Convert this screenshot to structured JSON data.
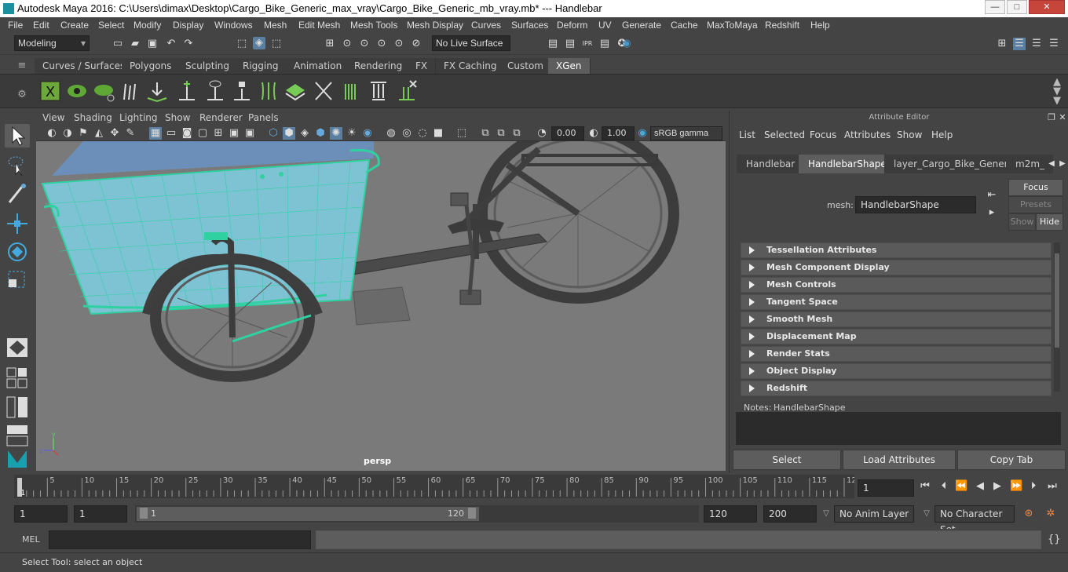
{
  "window": {
    "title": "Autodesk Maya 2016: C:\\Users\\dimax\\Desktop\\Cargo_Bike_Generic_max_vray\\Cargo_Bike_Generic_mb_vray.mb*   ---   Handlebar",
    "minimize": "—",
    "maximize": "□",
    "close": "✕"
  },
  "menu": [
    "File",
    "Edit",
    "Create",
    "Select",
    "Modify",
    "Display",
    "Windows",
    "Mesh",
    "Edit Mesh",
    "Mesh Tools",
    "Mesh Display",
    "Curves",
    "Surfaces",
    "Deform",
    "UV",
    "Generate",
    "Cache",
    "MaxToMaya",
    "Redshift",
    "Help"
  ],
  "status": {
    "mode": "Modeling",
    "live_surface": "No Live Surface"
  },
  "shelf_tabs": [
    "Curves / Surfaces",
    "Polygons",
    "Sculpting",
    "Rigging",
    "Animation",
    "Rendering",
    "FX",
    "FX Caching",
    "Custom",
    "XGen"
  ],
  "shelf_active": "XGen",
  "viewport": {
    "menu": [
      "View",
      "Shading",
      "Lighting",
      "Show",
      "Renderer",
      "Panels"
    ],
    "exposure": "0.00",
    "gamma": "1.00",
    "color_space": "sRGB gamma",
    "camera": "persp"
  },
  "attribute_editor": {
    "header": "Attribute Editor",
    "menu": [
      "List",
      "Selected",
      "Focus",
      "Attributes",
      "Show",
      "Help"
    ],
    "tabs": [
      "Handlebar",
      "HandlebarShape",
      "layer_Cargo_Bike_Generic",
      "m2m_"
    ],
    "active_tab": "HandlebarShape",
    "mesh_label": "mesh:",
    "mesh_value": "HandlebarShape",
    "focus": "Focus",
    "presets": "Presets",
    "show": "Show",
    "hide": "Hide",
    "sections": [
      "Tessellation Attributes",
      "Mesh Component Display",
      "Mesh Controls",
      "Tangent Space",
      "Smooth Mesh",
      "Displacement Map",
      "Render Stats",
      "Object Display",
      "Redshift"
    ],
    "notes_label": "Notes:",
    "notes_value": "HandlebarShape",
    "buttons": {
      "select": "Select",
      "load": "Load Attributes",
      "copy": "Copy Tab"
    }
  },
  "timeline": {
    "ticks": [
      "1",
      "5",
      "10",
      "15",
      "20",
      "25",
      "30",
      "35",
      "40",
      "45",
      "50",
      "55",
      "60",
      "65",
      "70",
      "75",
      "80",
      "85",
      "90",
      "95",
      "100",
      "105",
      "110",
      "115",
      "12"
    ],
    "current_frame": "1"
  },
  "range": {
    "start": "1",
    "anim_start": "1",
    "slider_start": "1",
    "slider_end": "120",
    "anim_end": "120",
    "end": "200",
    "anim_layer": "No Anim Layer",
    "char_set": "No Character Set"
  },
  "command": {
    "label": "MEL"
  },
  "help": "Select Tool: select an object"
}
